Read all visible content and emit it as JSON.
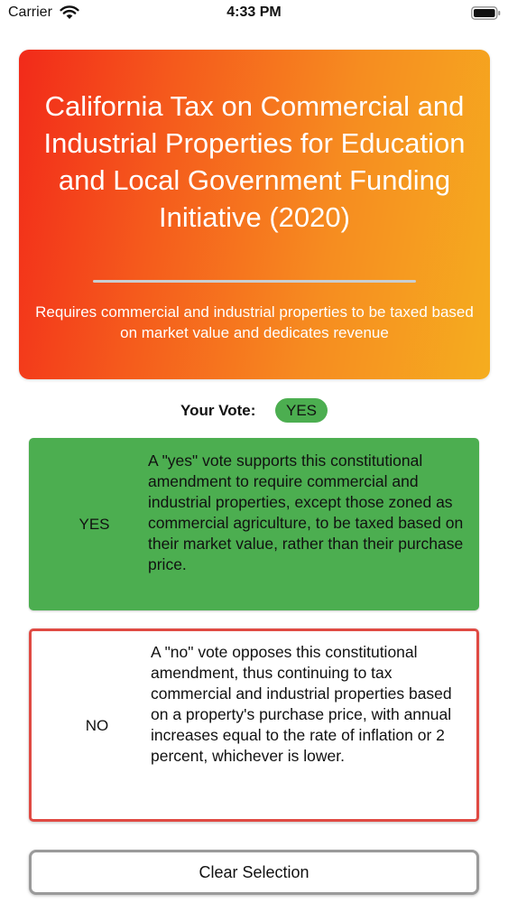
{
  "status_bar": {
    "carrier": "Carrier",
    "time": "4:33 PM",
    "wifi_icon": "wifi-icon",
    "battery_icon": "battery-icon"
  },
  "hero": {
    "title": "California Tax on Commercial and Industrial Properties for Education and Local Government Funding Initiative (2020)",
    "summary": "Requires commercial and industrial properties to be taxed based on market value and dedicates revenue",
    "gradient_start": "#f22a1a",
    "gradient_end": "#f5ad1f"
  },
  "vote": {
    "label": "Your Vote:",
    "selected": "YES",
    "badge_color": "#4cae50"
  },
  "options": [
    {
      "label": "YES",
      "description": "A \"yes\" vote supports this constitutional amendment to require commercial and industrial properties, except those zoned as commercial agriculture, to be taxed based on their market value, rather than their purchase price.",
      "color": "#4cae50"
    },
    {
      "label": "NO",
      "description": "A \"no\" vote opposes this constitutional amendment, thus continuing to tax commercial and industrial properties based on a property's purchase price, with annual increases equal to the rate of inflation or 2 percent, whichever is lower.",
      "color": "#e04a43"
    }
  ],
  "clear_button": {
    "label": "Clear Selection"
  }
}
